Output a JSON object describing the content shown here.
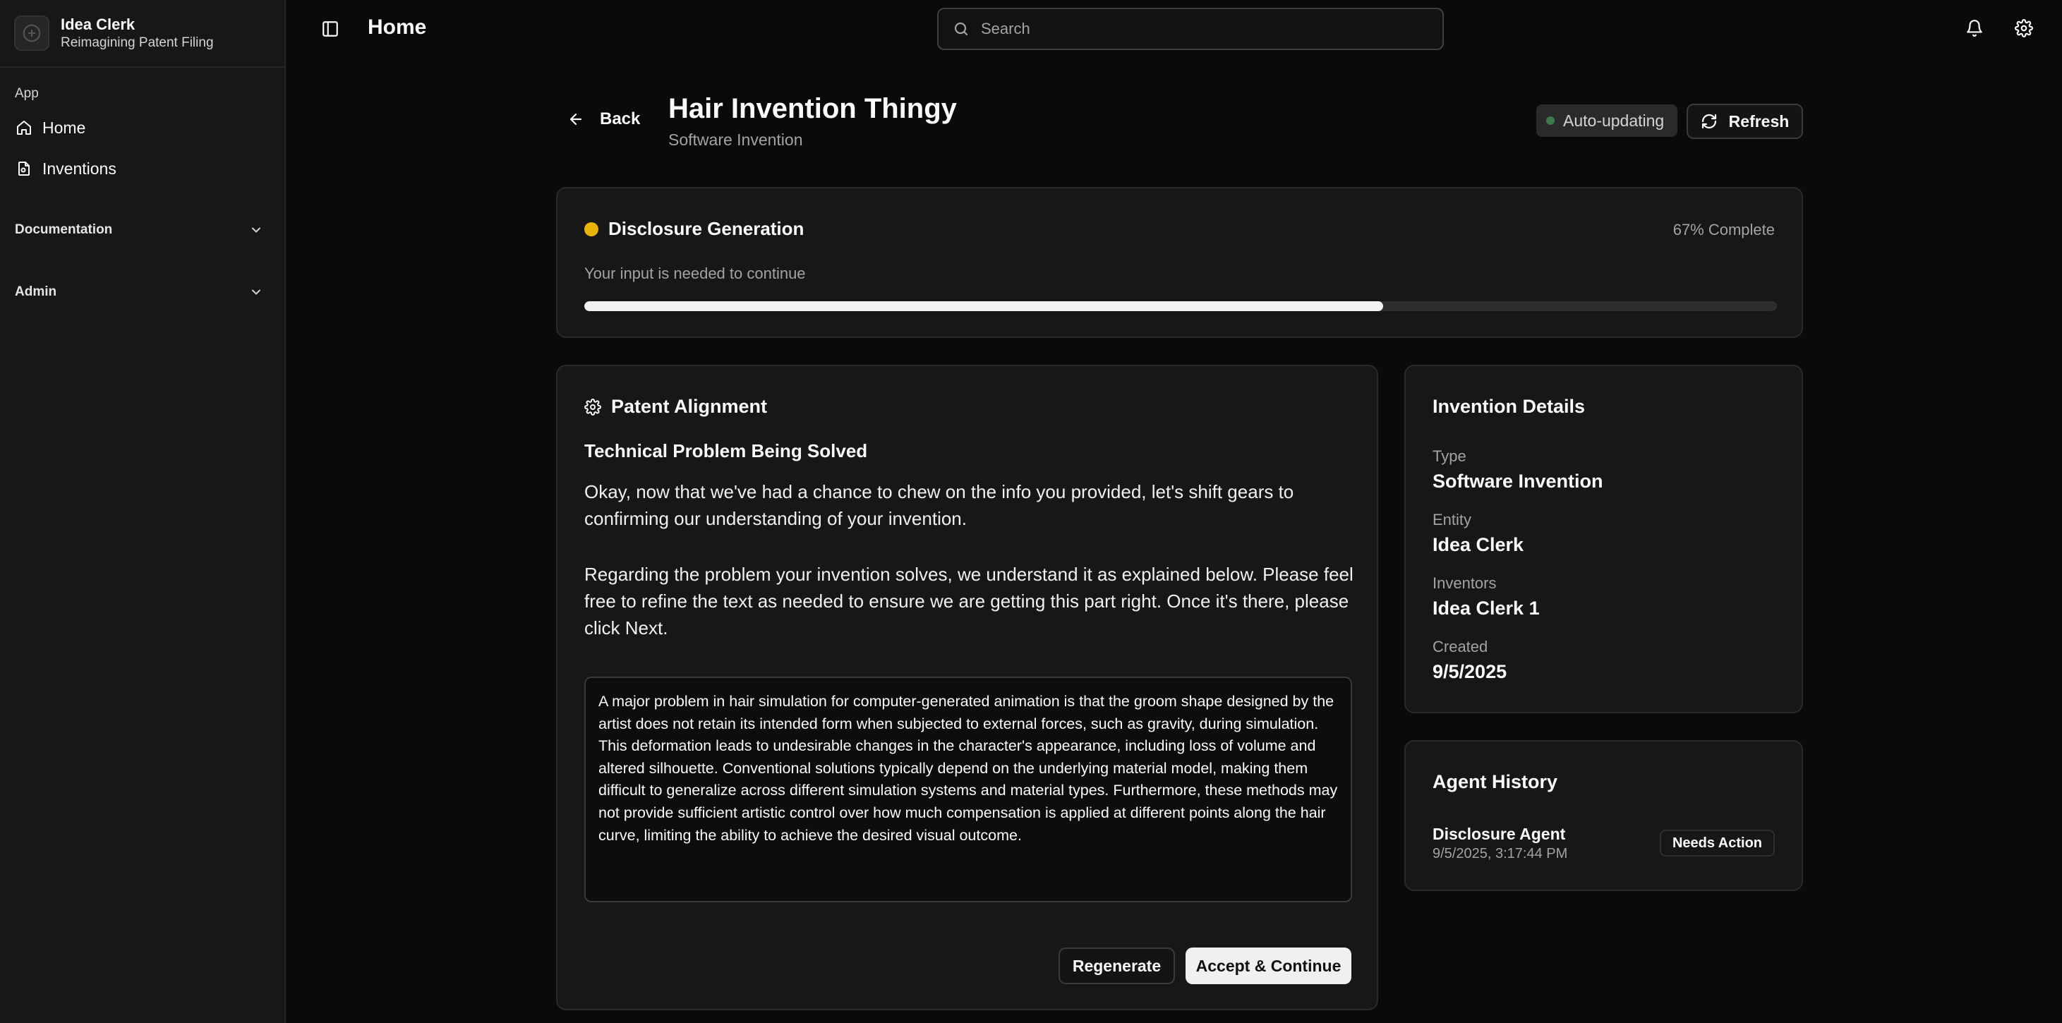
{
  "brand": {
    "name": "Idea Clerk",
    "tagline": "Reimagining Patent Filing"
  },
  "sidebar": {
    "group_label": "App",
    "items": [
      {
        "label": "Home",
        "icon": "home-icon"
      },
      {
        "label": "Inventions",
        "icon": "file-icon"
      }
    ],
    "sections": [
      {
        "label": "Documentation",
        "icon": "chevron-down-icon"
      },
      {
        "label": "Admin",
        "icon": "chevron-down-icon"
      }
    ]
  },
  "topbar": {
    "title": "Home",
    "search_placeholder": "Search"
  },
  "header": {
    "back_label": "Back",
    "title": "Hair Invention Thingy",
    "subtitle": "Software Invention",
    "auto_label": "Auto-updating",
    "refresh_label": "Refresh"
  },
  "progress": {
    "title": "Disclosure Generation",
    "percent_label": "67% Complete",
    "percent": 67,
    "subtitle": "Your input is needed to continue",
    "status_color": "#eab308"
  },
  "alignment": {
    "title": "Patent Alignment",
    "section_title": "Technical Problem Being Solved",
    "paragraph1": "Okay, now that we've had a chance to chew on the info you provided, let's shift gears to confirming our understanding of your invention.",
    "paragraph2": "Regarding the problem your invention solves, we understand it as explained below. Please feel free to refine the text as needed to ensure we are getting this part right. Once it's there, please click Next.",
    "problem_text": "A major problem in hair simulation for computer-generated animation is that the groom shape designed by the artist does not retain its intended form when subjected to external forces, such as gravity, during simulation. This deformation leads to undesirable changes in the character's appearance, including loss of volume and altered silhouette. Conventional solutions typically depend on the underlying material model, making them difficult to generalize across different simulation systems and material types. Furthermore, these methods may not provide sufficient artistic control over how much compensation is applied at different points along the hair curve, limiting the ability to achieve the desired visual outcome.",
    "regenerate_label": "Regenerate",
    "accept_label": "Accept & Continue"
  },
  "details": {
    "title": "Invention Details",
    "fields": [
      {
        "label": "Type",
        "value": "Software Invention"
      },
      {
        "label": "Entity",
        "value": "Idea Clerk"
      },
      {
        "label": "Inventors",
        "value": "Idea Clerk 1"
      },
      {
        "label": "Created",
        "value": "9/5/2025"
      }
    ]
  },
  "history": {
    "title": "Agent History",
    "entries": [
      {
        "name": "Disclosure Agent",
        "time": "9/5/2025, 3:17:44 PM",
        "status": "Needs Action"
      }
    ]
  }
}
